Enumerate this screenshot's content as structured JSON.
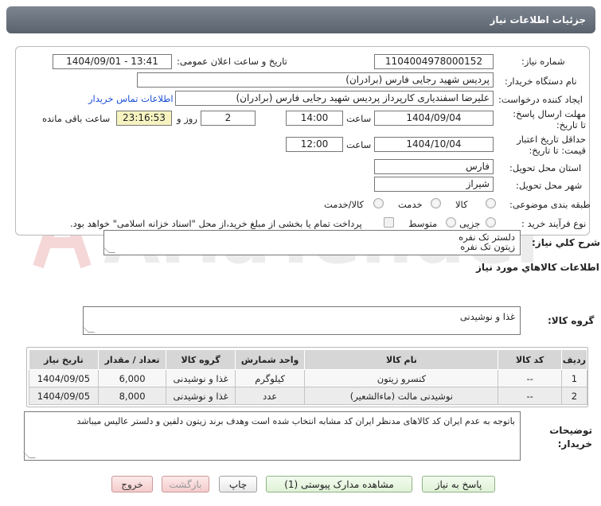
{
  "header": {
    "title": "جزئيات اطلاعات نياز"
  },
  "fields": {
    "need_number_label": "شماره نياز:",
    "need_number": "1104004978000152",
    "announce_label": "تاريخ و ساعت اعلان عمومی:",
    "announce_value": "1404/09/01 - 13:41",
    "buyer_org_label": "نام دستگاه خريدار:",
    "buyer_org": "پردیس شهید رجایی فارس (برادران)",
    "requester_label": "ايجاد کننده درخواست:",
    "requester": "علیرضا اسفندیاری کارپرداز پردیس شهید رجایی فارس (برادران)",
    "contact_link": "اطلاعات تماس خريدار",
    "deadline_label": "مهلت ارسال پاسخ: تا تاريخ:",
    "deadline_date": "1404/09/04",
    "time_label": "ساعت",
    "deadline_time": "14:00",
    "days_value": "2",
    "days_label": "روز و",
    "remaining_time": "23:16:53",
    "remaining_label": "ساعت باقی مانده",
    "validity_label": "حداقل تاريخ اعتبار قيمت: تا تاريخ:",
    "validity_date": "1404/10/04",
    "validity_time": "12:00",
    "province_label": "استان محل تحويل:",
    "province": "فارس",
    "city_label": "شهر محل تحويل:",
    "city": "شیراز",
    "category_label": "طبقه بندی موضوعی:",
    "category_options": [
      "کالا",
      "خدمت",
      "کالا/خدمت"
    ],
    "process_label": "نوع فرآیند خرید :",
    "process_options": [
      "جزیی",
      "متوسط"
    ],
    "payment_note": "پرداخت تمام یا بخشی از مبلغ خرید،از محل \"اسناد خزانه اسلامی\" خواهد بود."
  },
  "summary": {
    "label": "شرح كلي نياز:",
    "line1": "دلستر تک نفره",
    "line2": "زیتون تک نفره"
  },
  "goods": {
    "section_title": "اطلاعات كالاهاي مورد نياز",
    "group_label": "گروه كالا:",
    "group_value": "غذا و نوشیدنی"
  },
  "table": {
    "headers": [
      "رديف",
      "كد كالا",
      "نام كالا",
      "واحد شمارش",
      "گروه كالا",
      "تعداد / مقدار",
      "تاريخ نياز"
    ],
    "rows": [
      [
        "1",
        "--",
        "کنسرو زیتون",
        "کیلوگرم",
        "غذا و نوشیدنی",
        "6,000",
        "1404/09/05"
      ],
      [
        "2",
        "--",
        "نوشیدنی مالت (ماءالشعیر)",
        "عدد",
        "غذا و نوشیدنی",
        "8,000",
        "1404/09/05"
      ]
    ]
  },
  "buyer_notes": {
    "label": "توضيحات خريدار:",
    "text": "باتوجه به عدم ایران کد کالاهای مدنظر ایران کد مشابه انتخاب شده است  وهدف برند زیتون دلفین و دلستر عالیس میباشد"
  },
  "buttons": {
    "reply": "پاسخ به نياز",
    "docs": "مشاهده مدارک پیوستی (1)",
    "print": "چاپ",
    "back": "بازگشت",
    "exit": "خروج"
  },
  "watermark": {
    "text": "AriaTender.neT"
  }
}
